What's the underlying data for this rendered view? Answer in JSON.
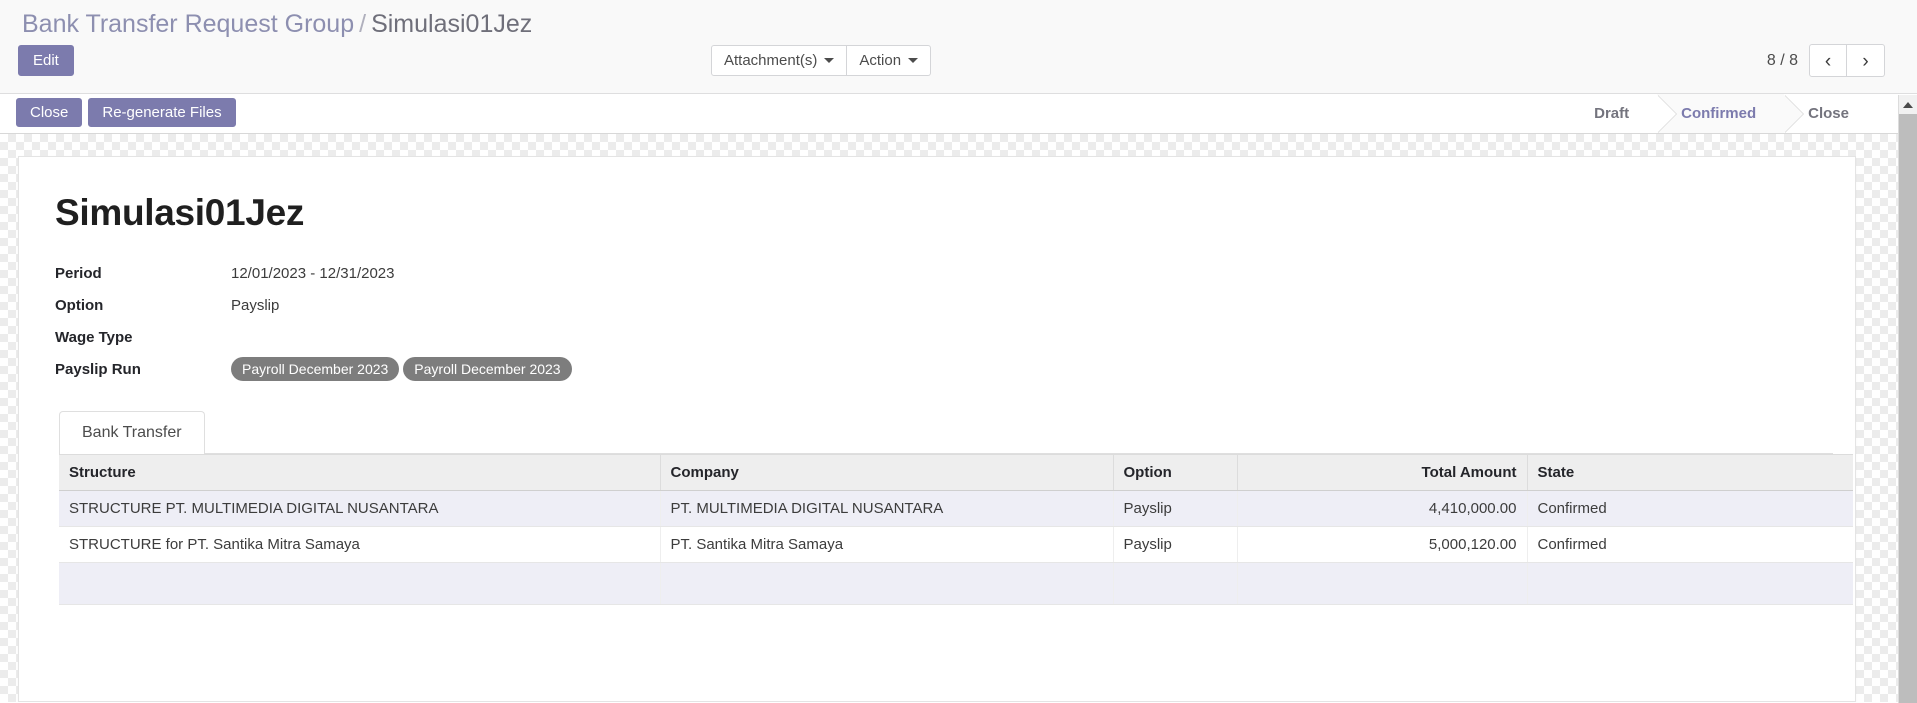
{
  "breadcrumb": {
    "parent": "Bank Transfer Request Group",
    "separator": "/",
    "current": "Simulasi01Jez"
  },
  "toolbar": {
    "edit_label": "Edit",
    "attachments_label": "Attachment(s)",
    "action_label": "Action",
    "pager_count": "8 / 8",
    "prev_label": "‹",
    "next_label": "›"
  },
  "controlbar": {
    "close_label": "Close",
    "regenerate_label": "Re-generate Files"
  },
  "statusbar": {
    "states": [
      {
        "label": "Draft",
        "active": false
      },
      {
        "label": "Confirmed",
        "active": true
      },
      {
        "label": "Close",
        "active": false
      }
    ],
    "active_color": "#7c7bad"
  },
  "record": {
    "title": "Simulasi01Jez",
    "fields": [
      {
        "label": "Period",
        "value": "12/01/2023 - 12/31/2023"
      },
      {
        "label": "Option",
        "value": "Payslip"
      },
      {
        "label": "Wage Type",
        "value": ""
      }
    ],
    "payslip_run": {
      "label": "Payslip Run",
      "tags": [
        "Payroll December 2023",
        "Payroll December 2023"
      ],
      "tag_color": "#7d7d7d"
    }
  },
  "notebook": {
    "tabs": [
      {
        "label": "Bank Transfer",
        "active": true
      }
    ]
  },
  "table": {
    "columns": [
      "Structure",
      "Company",
      "Option",
      "Total Amount",
      "State"
    ],
    "rows": [
      {
        "structure": "STRUCTURE PT. MULTIMEDIA DIGITAL NUSANTARA",
        "company": "PT. MULTIMEDIA DIGITAL NUSANTARA",
        "option": "Payslip",
        "total_amount": "4,410,000.00",
        "state": "Confirmed"
      },
      {
        "structure": "STRUCTURE for PT. Santika Mitra Samaya",
        "company": "PT. Santika Mitra Samaya",
        "option": "Payslip",
        "total_amount": "5,000,120.00",
        "state": "Confirmed"
      }
    ]
  }
}
